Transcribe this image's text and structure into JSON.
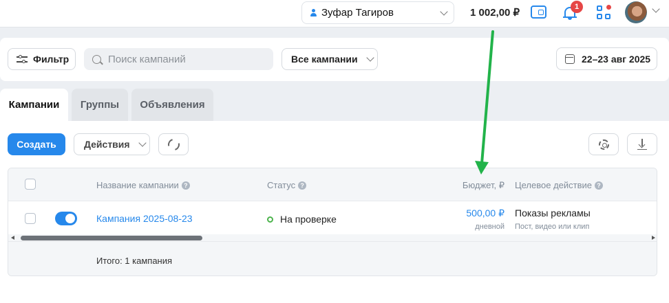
{
  "topbar": {
    "user_name": "Зуфар Тагиров",
    "balance": "1 002,00 ₽",
    "notifications_count": "1",
    "icons": [
      "person-icon",
      "chevron-down-icon",
      "wallet-icon",
      "bell-icon",
      "apps-grid-icon",
      "avatar"
    ]
  },
  "filters": {
    "filter_label": "Фильтр",
    "search_placeholder": "Поиск кампаний",
    "campaign_select": "Все кампании",
    "date_range": "22–23 авг 2025"
  },
  "tabs": [
    {
      "label": "Кампании",
      "active": true
    },
    {
      "label": "Группы",
      "active": false
    },
    {
      "label": "Объявления",
      "active": false
    }
  ],
  "toolbar": {
    "create_label": "Создать",
    "actions_label": "Действия"
  },
  "table": {
    "columns": {
      "name": "Название кампании",
      "status": "Статус",
      "budget": "Бюджет, ₽",
      "target": "Целевое действие"
    },
    "rows": [
      {
        "enabled": true,
        "name": "Кампания 2025-08-23",
        "status": "На проверке",
        "budget": "500,00 ₽",
        "budget_type": "дневной",
        "target": "Показы рекламы",
        "target_sub": "Пост, видео или клип"
      }
    ],
    "total": "Итого: 1 кампания"
  },
  "colors": {
    "accent": "#2688eb",
    "status_ok": "#4bb34b",
    "badge": "#e64646",
    "annotation_arrow": "#22b34a"
  }
}
